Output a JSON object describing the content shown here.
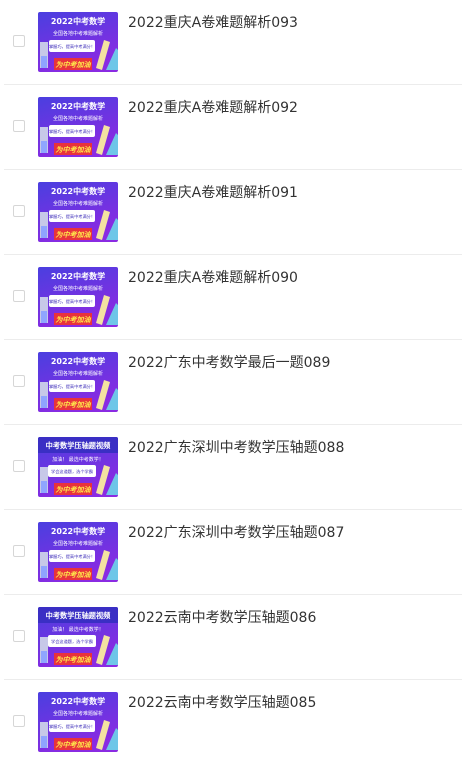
{
  "colors": {
    "thumb_bg_top": "#4a3fe0",
    "thumb_bg_bottom": "#8a2be2",
    "banner_red": "#e8323c",
    "banner_text_yellow": "#ffe94a",
    "title_text": "#333333"
  },
  "items": [
    {
      "title": "2022重庆A卷难题解析093",
      "thumb": {
        "variant": "A",
        "headline": "2022中考数学",
        "subtitle": "全国各地中考难题解析",
        "card_text": "掌握巧，提高中考满分！",
        "banner": "为中考加油"
      }
    },
    {
      "title": "2022重庆A卷难题解析092",
      "thumb": {
        "variant": "A",
        "headline": "2022中考数学",
        "subtitle": "全国各地中考难题解析",
        "card_text": "掌握巧，提高中考满分！",
        "banner": "为中考加油"
      }
    },
    {
      "title": "2022重庆A卷难题解析091",
      "thumb": {
        "variant": "A",
        "headline": "2022中考数学",
        "subtitle": "全国各地中考难题解析",
        "card_text": "掌握巧，提高中考满分！",
        "banner": "为中考加油"
      }
    },
    {
      "title": "2022重庆A卷难题解析090",
      "thumb": {
        "variant": "A",
        "headline": "2022中考数学",
        "subtitle": "全国各地中考难题解析",
        "card_text": "掌握巧，提高中考满分！",
        "banner": "为中考加油"
      }
    },
    {
      "title": "2022广东中考数学最后一题089",
      "thumb": {
        "variant": "A",
        "headline": "2022中考数学",
        "subtitle": "全国各地中考难题解析",
        "card_text": "掌握巧，提高中考满分！",
        "banner": "为中考加油"
      }
    },
    {
      "title": "2022广东深圳中考数学压轴题088",
      "thumb": {
        "variant": "B",
        "headline": "中考数学压轴题视频",
        "subtitle": "加油！ 最选中考数学！",
        "card_text": "学会这道题，选个学霸",
        "banner": "为中考加油"
      }
    },
    {
      "title": "2022广东深圳中考数学压轴题087",
      "thumb": {
        "variant": "A",
        "headline": "2022中考数学",
        "subtitle": "全国各地中考难题解析",
        "card_text": "掌握巧，提高中考满分！",
        "banner": "为中考加油"
      }
    },
    {
      "title": "2022云南中考数学压轴题086",
      "thumb": {
        "variant": "B",
        "headline": "中考数学压轴题视频",
        "subtitle": "加油！ 最选中考数学！",
        "card_text": "学会这道题，选个学霸",
        "banner": "为中考加油"
      }
    },
    {
      "title": "2022云南中考数学压轴题085",
      "thumb": {
        "variant": "A",
        "headline": "2022中考数学",
        "subtitle": "全国各地中考难题解析",
        "card_text": "掌握巧，提高中考满分！",
        "banner": "为中考加油"
      }
    }
  ]
}
